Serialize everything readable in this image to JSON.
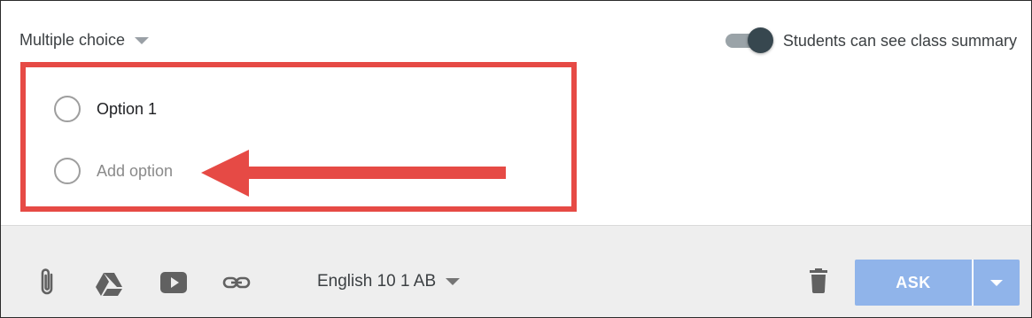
{
  "question": {
    "type_label": "Multiple choice",
    "summary_toggle": {
      "label": "Students can see class summary",
      "on": true
    },
    "options": [
      {
        "label": "Option 1"
      }
    ],
    "add_option_placeholder": "Add option"
  },
  "annotation": {
    "color": "#e64a45"
  },
  "footer": {
    "icons": [
      "paperclip-icon",
      "google-drive-icon",
      "youtube-icon",
      "link-icon",
      "trash-icon"
    ],
    "class_label": "English 10 1 AB",
    "ask_label": "ASK",
    "ask_color": "#90b4ea"
  }
}
